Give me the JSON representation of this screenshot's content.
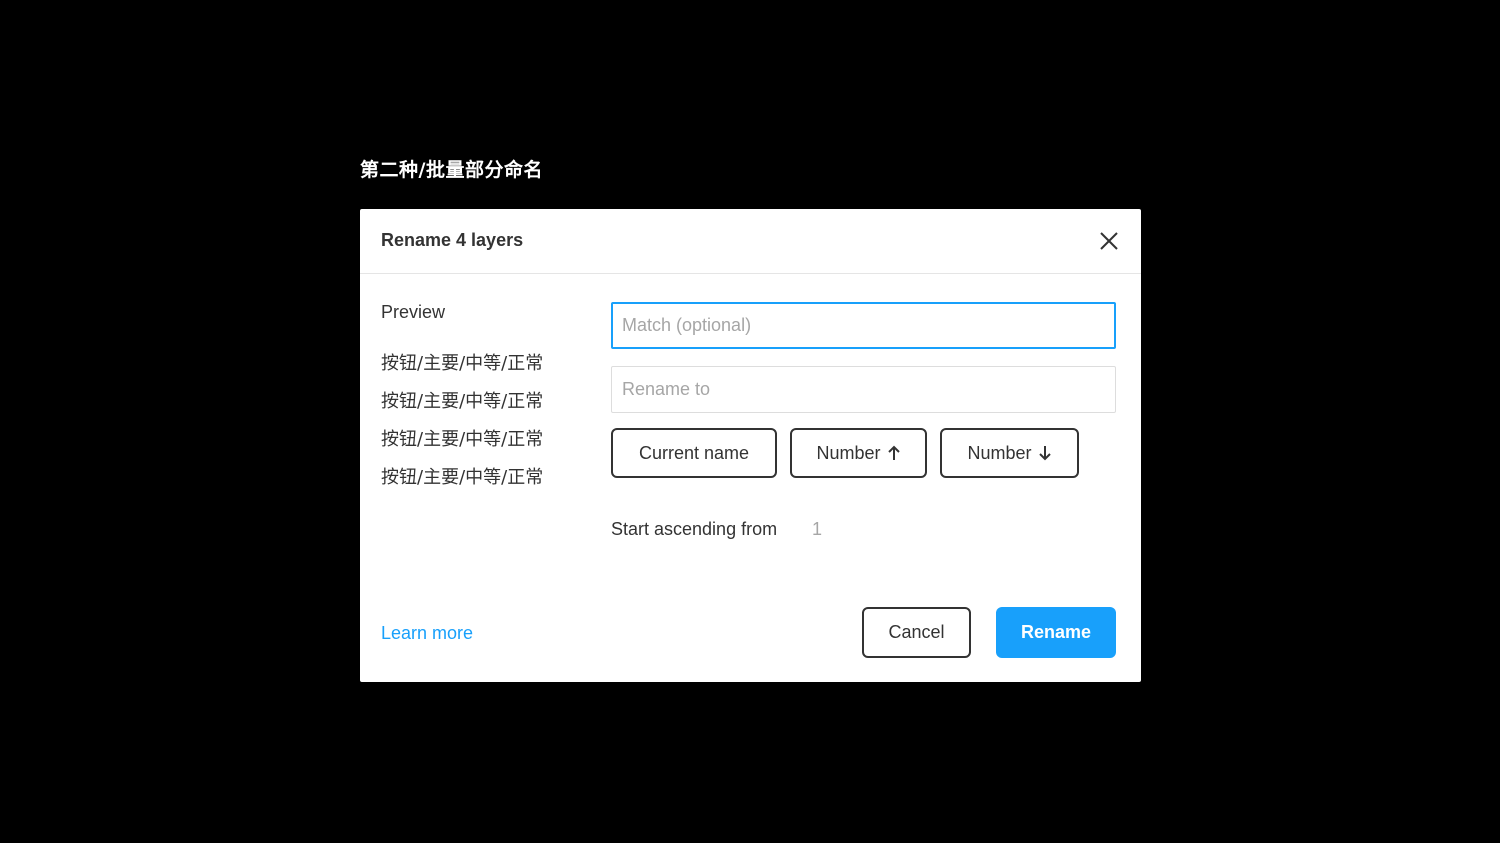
{
  "caption": "第二种/批量部分命名",
  "dialog": {
    "title": "Rename 4 layers",
    "close_icon": "close-icon"
  },
  "preview": {
    "label": "Preview",
    "items": [
      "按钮/主要/中等/正常",
      "按钮/主要/中等/正常",
      "按钮/主要/中等/正常",
      "按钮/主要/中等/正常"
    ]
  },
  "fields": {
    "match_placeholder": "Match (optional)",
    "match_value": "",
    "rename_placeholder": "Rename to",
    "rename_value": ""
  },
  "chips": {
    "current_name": "Current name",
    "number_asc": "Number",
    "number_asc_icon": "arrow-up-icon",
    "number_desc": "Number",
    "number_desc_icon": "arrow-down-icon"
  },
  "start": {
    "label": "Start ascending from",
    "value": "1"
  },
  "footer": {
    "learn_more": "Learn more",
    "cancel": "Cancel",
    "rename": "Rename"
  },
  "colors": {
    "accent": "#18a0fb",
    "background": "#000000",
    "dialog": "#ffffff",
    "text": "#333333",
    "placeholder": "#a6a6a6"
  }
}
